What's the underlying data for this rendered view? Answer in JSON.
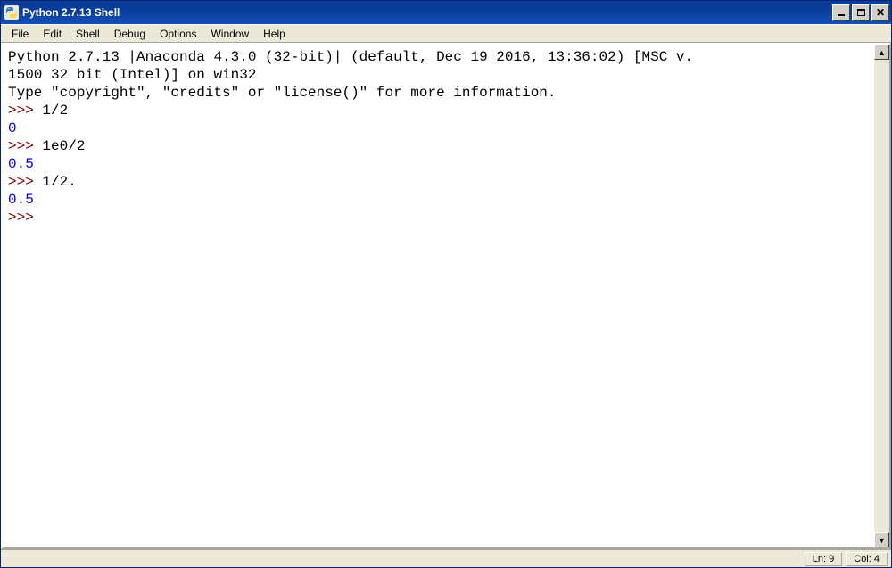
{
  "window": {
    "title": "Python 2.7.13 Shell"
  },
  "menu": {
    "file": "File",
    "edit": "Edit",
    "shell": "Shell",
    "debug": "Debug",
    "options": "Options",
    "window": "Window",
    "help": "Help"
  },
  "console": {
    "banner_line1": "Python 2.7.13 |Anaconda 4.3.0 (32-bit)| (default, Dec 19 2016, 13:36:02) [MSC v.",
    "banner_line2": "1500 32 bit (Intel)] on win32",
    "banner_line3": "Type \"copyright\", \"credits\" or \"license()\" for more information.",
    "prompt": ">>> ",
    "input1": "1/2",
    "output1": "0",
    "input2": "1e0/2",
    "output2": "0.5",
    "input3": "1/2.",
    "output3": "0.5"
  },
  "status": {
    "ln_label": "Ln: ",
    "ln_value": "9",
    "col_label": "Col: ",
    "col_value": "4"
  },
  "scroll": {
    "up": "▲",
    "down": "▼"
  }
}
